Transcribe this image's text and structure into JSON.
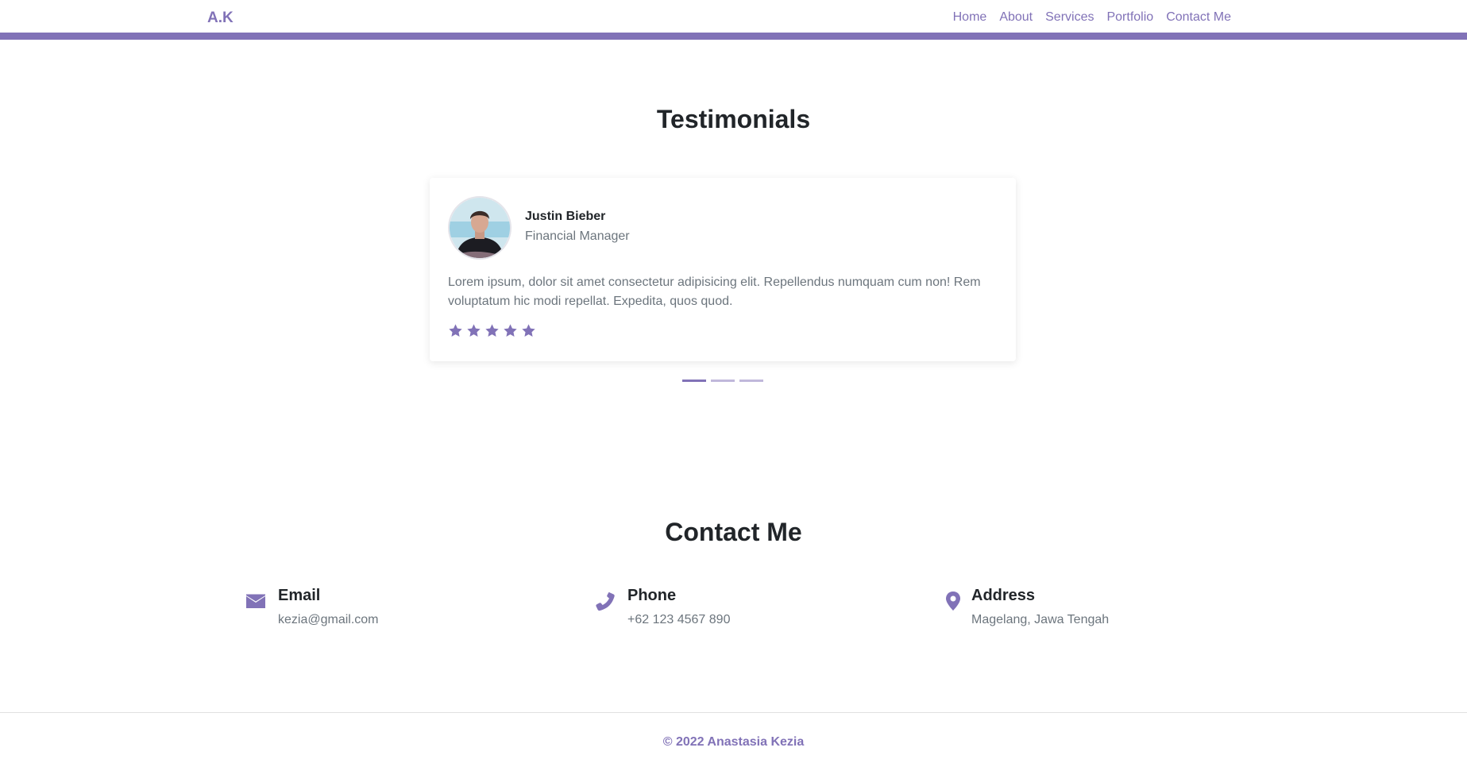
{
  "nav": {
    "brand": "A.K",
    "links": [
      "Home",
      "About",
      "Services",
      "Portfolio",
      "Contact Me"
    ]
  },
  "testimonials": {
    "title": "Testimonials",
    "card": {
      "name": "Justin Bieber",
      "role": "Financial Manager",
      "text": "Lorem ipsum, dolor sit amet consectetur adipisicing elit. Repellendus numquam cum non! Rem voluptatum hic modi repellat. Expedita, quos quod.",
      "rating": 5
    },
    "slides": 3,
    "active_slide": 1
  },
  "contact": {
    "title": "Contact Me",
    "items": [
      {
        "title": "Email",
        "value": "kezia@gmail.com",
        "icon": "envelope-icon"
      },
      {
        "title": "Phone",
        "value": "+62 123 4567 890",
        "icon": "phone-icon"
      },
      {
        "title": "Address",
        "value": "Magelang, Jawa Tengah",
        "icon": "map-pin-icon"
      }
    ]
  },
  "footer": {
    "text": "© 2022 Anastasia Kezia"
  },
  "colors": {
    "accent": "#8172b7",
    "text": "#212529",
    "muted": "#6c757d"
  }
}
